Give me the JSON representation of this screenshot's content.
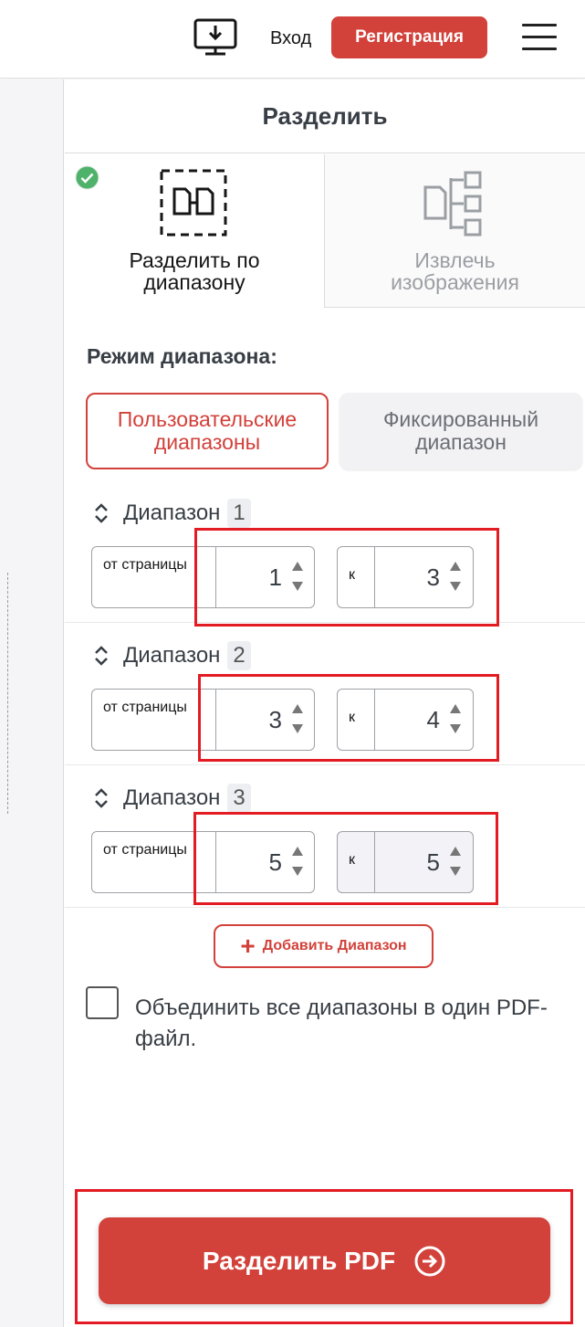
{
  "header": {
    "download_icon": "desktop-download-icon",
    "login_label": "Вход",
    "register_label": "Регистрация",
    "menu_icon": "hamburger-menu-icon"
  },
  "panel": {
    "title": "Разделить",
    "tabs": [
      {
        "label": "Разделить по диапазону",
        "icon": "split-range-icon",
        "active": true,
        "checked": true
      },
      {
        "label": "Извлечь изображения",
        "icon": "extract-images-icon",
        "active": false
      }
    ],
    "range_mode_label": "Режим диапазона:",
    "range_modes": [
      {
        "label": "Пользовательские диапазоны",
        "active": true
      },
      {
        "label": "Фиксированный диапазон",
        "active": false
      }
    ],
    "ranges": [
      {
        "title": "Диапазон",
        "number": "1",
        "from_label": "от страницы",
        "from_value": "1",
        "to_label": "к",
        "to_value": "3"
      },
      {
        "title": "Диапазон",
        "number": "2",
        "from_label": "от страницы",
        "from_value": "3",
        "to_label": "к",
        "to_value": "4"
      },
      {
        "title": "Диапазон",
        "number": "3",
        "from_label": "от страницы",
        "from_value": "5",
        "to_label": "к",
        "to_value": "5"
      }
    ],
    "add_range_label": "Добавить Диапазон",
    "merge_label": "Объединить все диапазоны в один PDF-файл.",
    "merge_checked": false,
    "split_button_label": "Разделить PDF"
  },
  "colors": {
    "accent": "#d2413a",
    "highlight_border": "#e31b23",
    "check_green": "#4fb26b"
  }
}
